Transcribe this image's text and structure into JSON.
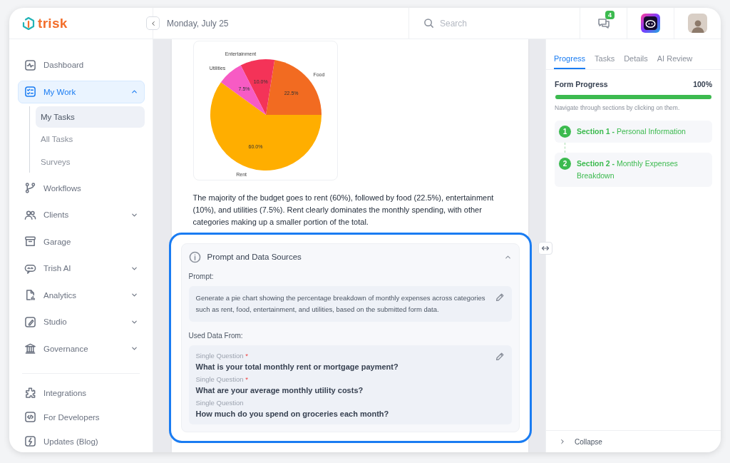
{
  "header": {
    "logo": "trisk",
    "date": "Monday, July 25",
    "search": {
      "placeholder": "Search"
    },
    "notifications_badge": "4"
  },
  "sidebar": {
    "items": [
      {
        "label": "Dashboard",
        "selected": false
      },
      {
        "label": "My Work",
        "selected": true,
        "expanded": true,
        "children": [
          {
            "label": "My Tasks",
            "selected": true
          },
          {
            "label": "All Tasks",
            "selected": false
          },
          {
            "label": "Surveys",
            "selected": false
          }
        ]
      },
      {
        "label": "Workflows",
        "selected": false
      },
      {
        "label": "Clients",
        "selected": false,
        "expanded": false
      },
      {
        "label": "Garage",
        "selected": false
      },
      {
        "label": "Trish AI",
        "selected": false,
        "expanded": false
      },
      {
        "label": "Analytics",
        "selected": false,
        "expanded": false
      },
      {
        "label": "Studio",
        "selected": false,
        "expanded": false
      },
      {
        "label": "Governance",
        "selected": false,
        "expanded": false
      }
    ],
    "bottom_items": [
      {
        "label": "Integrations",
        "selected": false
      },
      {
        "label": "For Developers",
        "selected": false
      },
      {
        "label": "Updates (Blog)",
        "selected": false
      }
    ]
  },
  "content": {
    "chart_data": {
      "type": "pie",
      "categories": [
        "Rent",
        "Food",
        "Entertainment",
        "Utilities"
      ],
      "values": [
        60,
        22.5,
        10,
        7.5
      ],
      "colors": [
        "#ffae00",
        "#f26b21",
        "#f43358",
        "#f75bc4"
      ],
      "value_labels": [
        "60.0%",
        "22.5%",
        "10.0%",
        "7.5%"
      ]
    },
    "summary": "The majority of the budget goes to rent (60%), followed by food (22.5%), entertainment (10%), and utilities (7.5%). Rent clearly dominates the monthly spending, with other categories making up a smaller portion of the total."
  },
  "prompt_card": {
    "title": "Prompt and Data Sources",
    "expanded": true,
    "prompt_label": "Prompt:",
    "prompt": "Generate a pie chart showing the percentage breakdown of monthly expenses across categories such as rent, food, entertainment, and utilities, based on the submitted form data.",
    "sources_label": "Used Data From:",
    "sources": [
      {
        "type": "Single Question",
        "required_mark": "*",
        "question": "What is your total monthly rent or mortgage payment?"
      },
      {
        "type": "Single Question",
        "required_mark": "*",
        "question": "What are your average monthly utility costs?"
      },
      {
        "type": "Single Question",
        "question": "How much do you spend on groceries each month?"
      }
    ]
  },
  "side_panel": {
    "tabs": [
      {
        "label": "Progress",
        "selected": true
      },
      {
        "label": "Tasks",
        "selected": false
      },
      {
        "label": "Details",
        "selected": false
      },
      {
        "label": "AI Review",
        "selected": false
      }
    ],
    "progress_label": "Form Progress",
    "progress_value": "100%",
    "level": 1,
    "hint": "Navigate through sections by clicking on them.",
    "sections": [
      {
        "number": "1",
        "title": "**Section 1 -** Personal Information"
      },
      {
        "number": "2",
        "title": "**Section 2 -** Monthly Expenses Breakdown"
      }
    ],
    "collapse": "Collapse"
  }
}
